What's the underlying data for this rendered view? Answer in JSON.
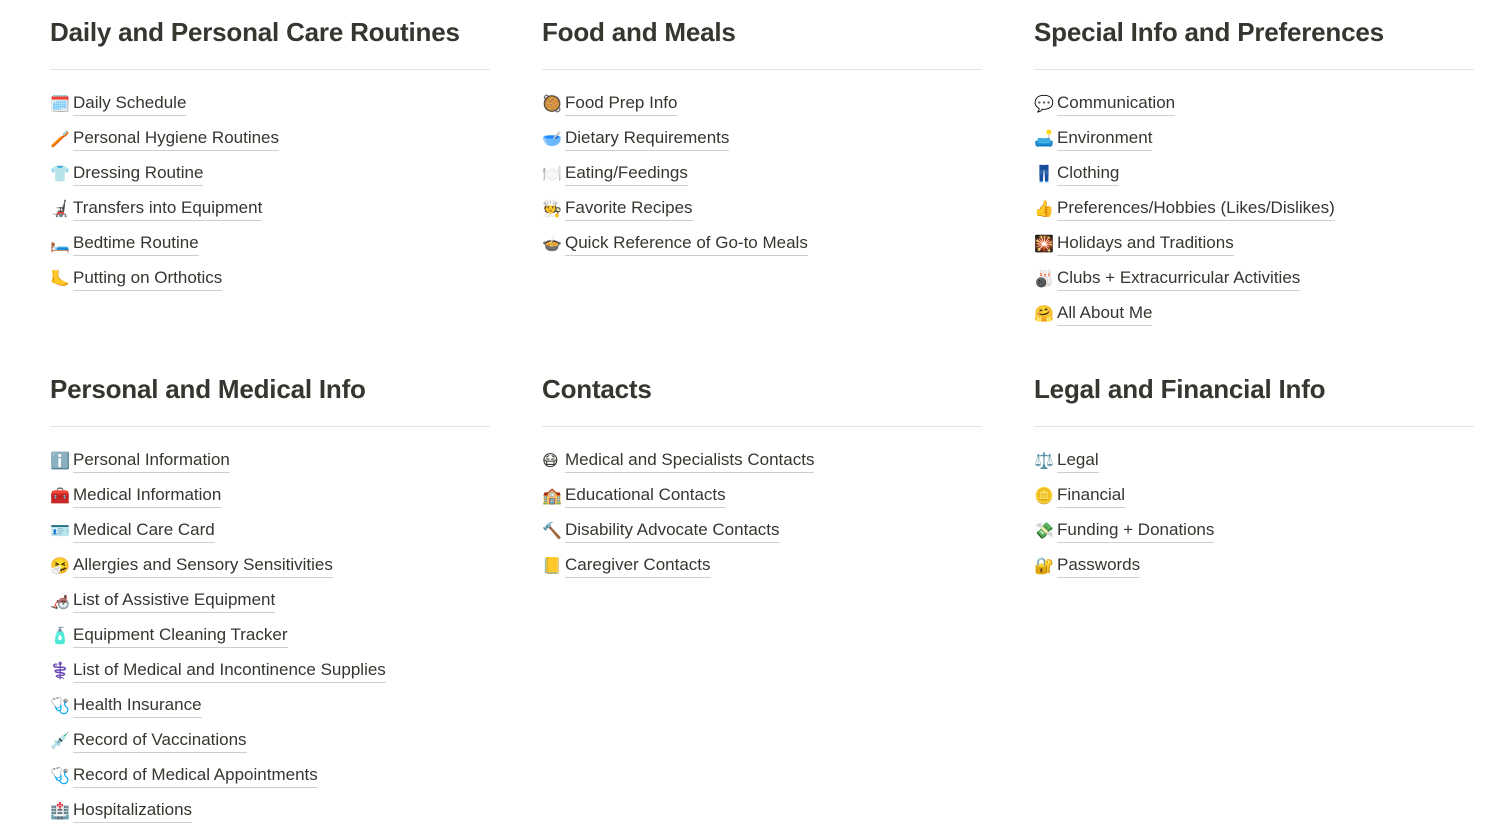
{
  "page": {
    "layout": "six-section-link-directory",
    "background_color": "#ffffff",
    "heading_color": "#37352f",
    "rule_color": "#e3e2e0",
    "link_underline_color": "#cfcecb"
  },
  "sections": [
    {
      "id": "daily-and-personal-care-routines",
      "title": "Daily and Personal Care Routines",
      "links": [
        {
          "icon": "spiral-calendar-icon",
          "glyph": "🗓️",
          "label": "Daily Schedule"
        },
        {
          "icon": "toothbrush-icon",
          "glyph": "🪥",
          "label": "Personal Hygiene Routines"
        },
        {
          "icon": "t-shirt-icon",
          "glyph": "👕",
          "label": "Dressing Routine"
        },
        {
          "icon": "motorized-wheelchair-icon",
          "glyph": "🦼",
          "label": "Transfers into Equipment"
        },
        {
          "icon": "bed-icon",
          "glyph": "🛏️",
          "label": "Bedtime Routine"
        },
        {
          "icon": "foot-icon",
          "glyph": "🦶",
          "label": "Putting on Orthotics"
        }
      ]
    },
    {
      "id": "food-and-meals",
      "title": "Food and Meals",
      "links": [
        {
          "icon": "shallow-pan-of-food-icon",
          "glyph": "🥘",
          "label": "Food Prep Info"
        },
        {
          "icon": "bowl-with-spoon-icon",
          "glyph": "🥣",
          "label": "Dietary Requirements"
        },
        {
          "icon": "fork-and-knife-with-plate-icon",
          "glyph": "🍽️",
          "label": "Eating/Feedings"
        },
        {
          "icon": "cook-icon",
          "glyph": "🧑‍🍳",
          "label": "Favorite Recipes"
        },
        {
          "icon": "pot-of-food-icon",
          "glyph": "🍲",
          "label": "Quick Reference of Go-to Meals"
        }
      ]
    },
    {
      "id": "special-info-and-preferences",
      "title": "Special Info and Preferences",
      "links": [
        {
          "icon": "speech-balloon-icon",
          "glyph": "💬",
          "label": "Communication"
        },
        {
          "icon": "couch-icon",
          "glyph": "🛋️",
          "label": "Environment"
        },
        {
          "icon": "jeans-icon",
          "glyph": "👖",
          "label": "Clothing"
        },
        {
          "icon": "thumbs-up-icon",
          "glyph": "👍",
          "label": "Preferences/Hobbies (Likes/Dislikes)"
        },
        {
          "icon": "sparkler-icon",
          "glyph": "🎇",
          "label": "Holidays and Traditions"
        },
        {
          "icon": "bowling-icon",
          "glyph": "🎳",
          "label": "Clubs + Extracurricular Activities"
        },
        {
          "icon": "hugging-face-icon",
          "glyph": "🤗",
          "label": "All About Me"
        }
      ]
    },
    {
      "id": "personal-and-medical-info",
      "title": "Personal and Medical Info",
      "links": [
        {
          "icon": "information-icon",
          "glyph": "ℹ️",
          "label": "Personal Information"
        },
        {
          "icon": "first-aid-kit-icon",
          "glyph": "🧰",
          "label": "Medical Information"
        },
        {
          "icon": "identification-card-icon",
          "glyph": "🪪",
          "label": "Medical Care Card"
        },
        {
          "icon": "sneezing-face-icon",
          "glyph": "🤧",
          "label": "Allergies and Sensory Sensitivities"
        },
        {
          "icon": "manual-wheelchair-icon",
          "glyph": "🦽",
          "label": "List of Assistive Equipment"
        },
        {
          "icon": "lotion-bottle-icon",
          "glyph": "🧴",
          "label": "Equipment Cleaning Tracker"
        },
        {
          "icon": "medical-symbol-icon",
          "glyph": "⚕️",
          "label": "List of Medical and Incontinence Supplies"
        },
        {
          "icon": "stethoscope-blue-icon",
          "glyph": "🩺",
          "label": "Health Insurance"
        },
        {
          "icon": "syringe-icon",
          "glyph": "💉",
          "label": "Record of Vaccinations"
        },
        {
          "icon": "stethoscope-icon",
          "glyph": "🩺",
          "label": "Record of Medical Appointments"
        },
        {
          "icon": "hospital-icon",
          "glyph": "🏥",
          "label": "Hospitalizations"
        }
      ]
    },
    {
      "id": "contacts",
      "title": "Contacts",
      "links": [
        {
          "icon": "face-with-medical-mask-icon",
          "glyph": "😷",
          "label": "Medical and Specialists Contacts"
        },
        {
          "icon": "school-icon",
          "glyph": "🏫",
          "label": "Educational Contacts"
        },
        {
          "icon": "hammer-icon",
          "glyph": "🔨",
          "label": "Disability Advocate Contacts"
        },
        {
          "icon": "ledger-icon",
          "glyph": "📒",
          "label": "Caregiver Contacts"
        }
      ]
    },
    {
      "id": "legal-and-financial-info",
      "title": "Legal and Financial Info",
      "links": [
        {
          "icon": "balance-scale-icon",
          "glyph": "⚖️",
          "label": "Legal"
        },
        {
          "icon": "coin-icon",
          "glyph": "🪙",
          "label": "Financial"
        },
        {
          "icon": "money-with-wings-icon",
          "glyph": "💸",
          "label": "Funding + Donations"
        },
        {
          "icon": "locked-with-key-icon",
          "glyph": "🔐",
          "label": "Passwords"
        }
      ]
    }
  ]
}
